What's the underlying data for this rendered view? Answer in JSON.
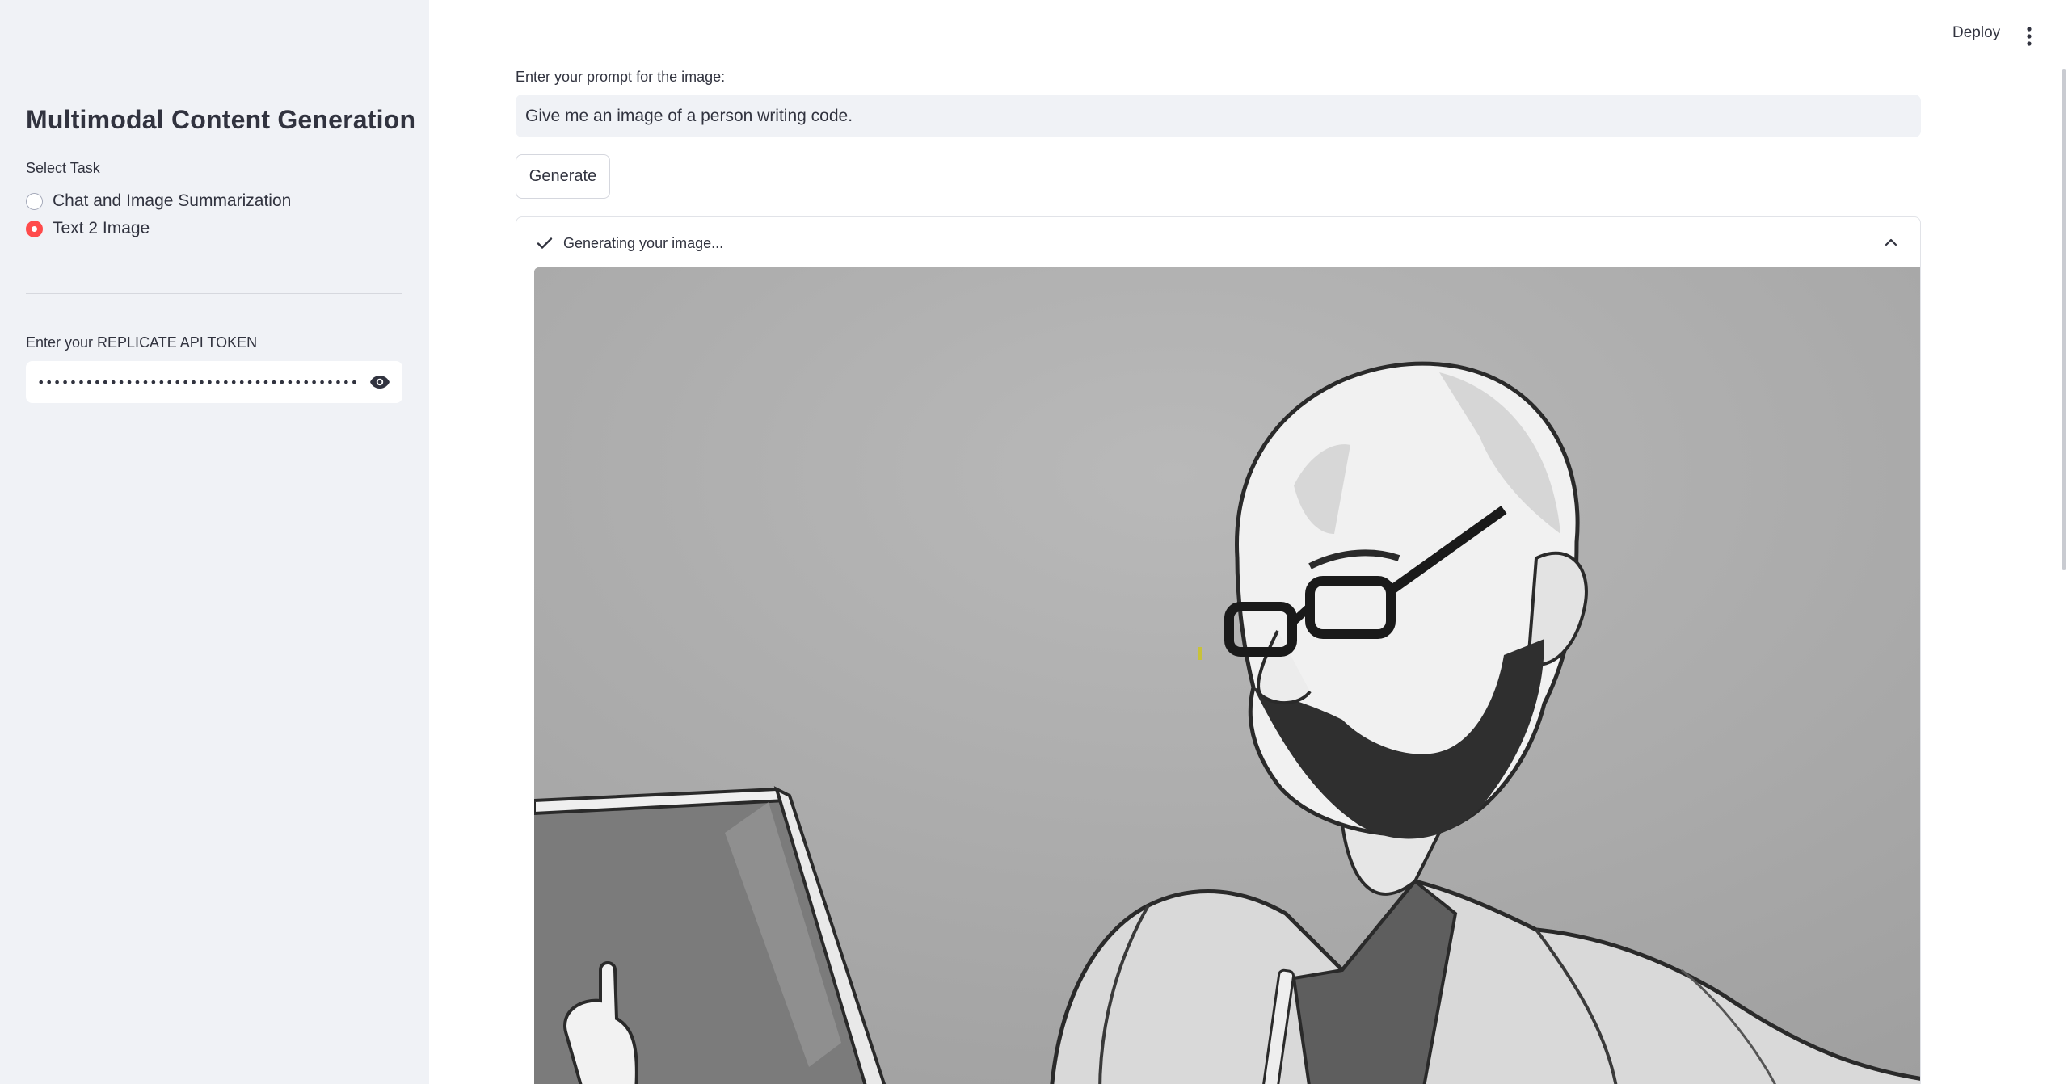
{
  "sidebar": {
    "title": "Multimodal Content Generation",
    "task_label": "Select Task",
    "tasks": [
      {
        "label": "Chat and Image Summarization",
        "checked": false
      },
      {
        "label": "Text 2 Image",
        "checked": true
      }
    ],
    "token_label": "Enter your REPLICATE API TOKEN",
    "token_value": "••••••••••••••••••••••••••••••••••••••••"
  },
  "header": {
    "deploy_label": "Deploy"
  },
  "main": {
    "prompt_label": "Enter your prompt for the image:",
    "prompt_value": "Give me an image of a person writing code.",
    "generate_label": "Generate",
    "status_text": "Generating your image..."
  },
  "colors": {
    "accent": "#ff4b4b",
    "sidebar_bg": "#f0f2f6",
    "text": "#31333f"
  },
  "icons": {
    "eye": "eye-icon",
    "menu": "vertical-dots-icon",
    "check": "check-icon",
    "chevron": "chevron-up-icon"
  }
}
